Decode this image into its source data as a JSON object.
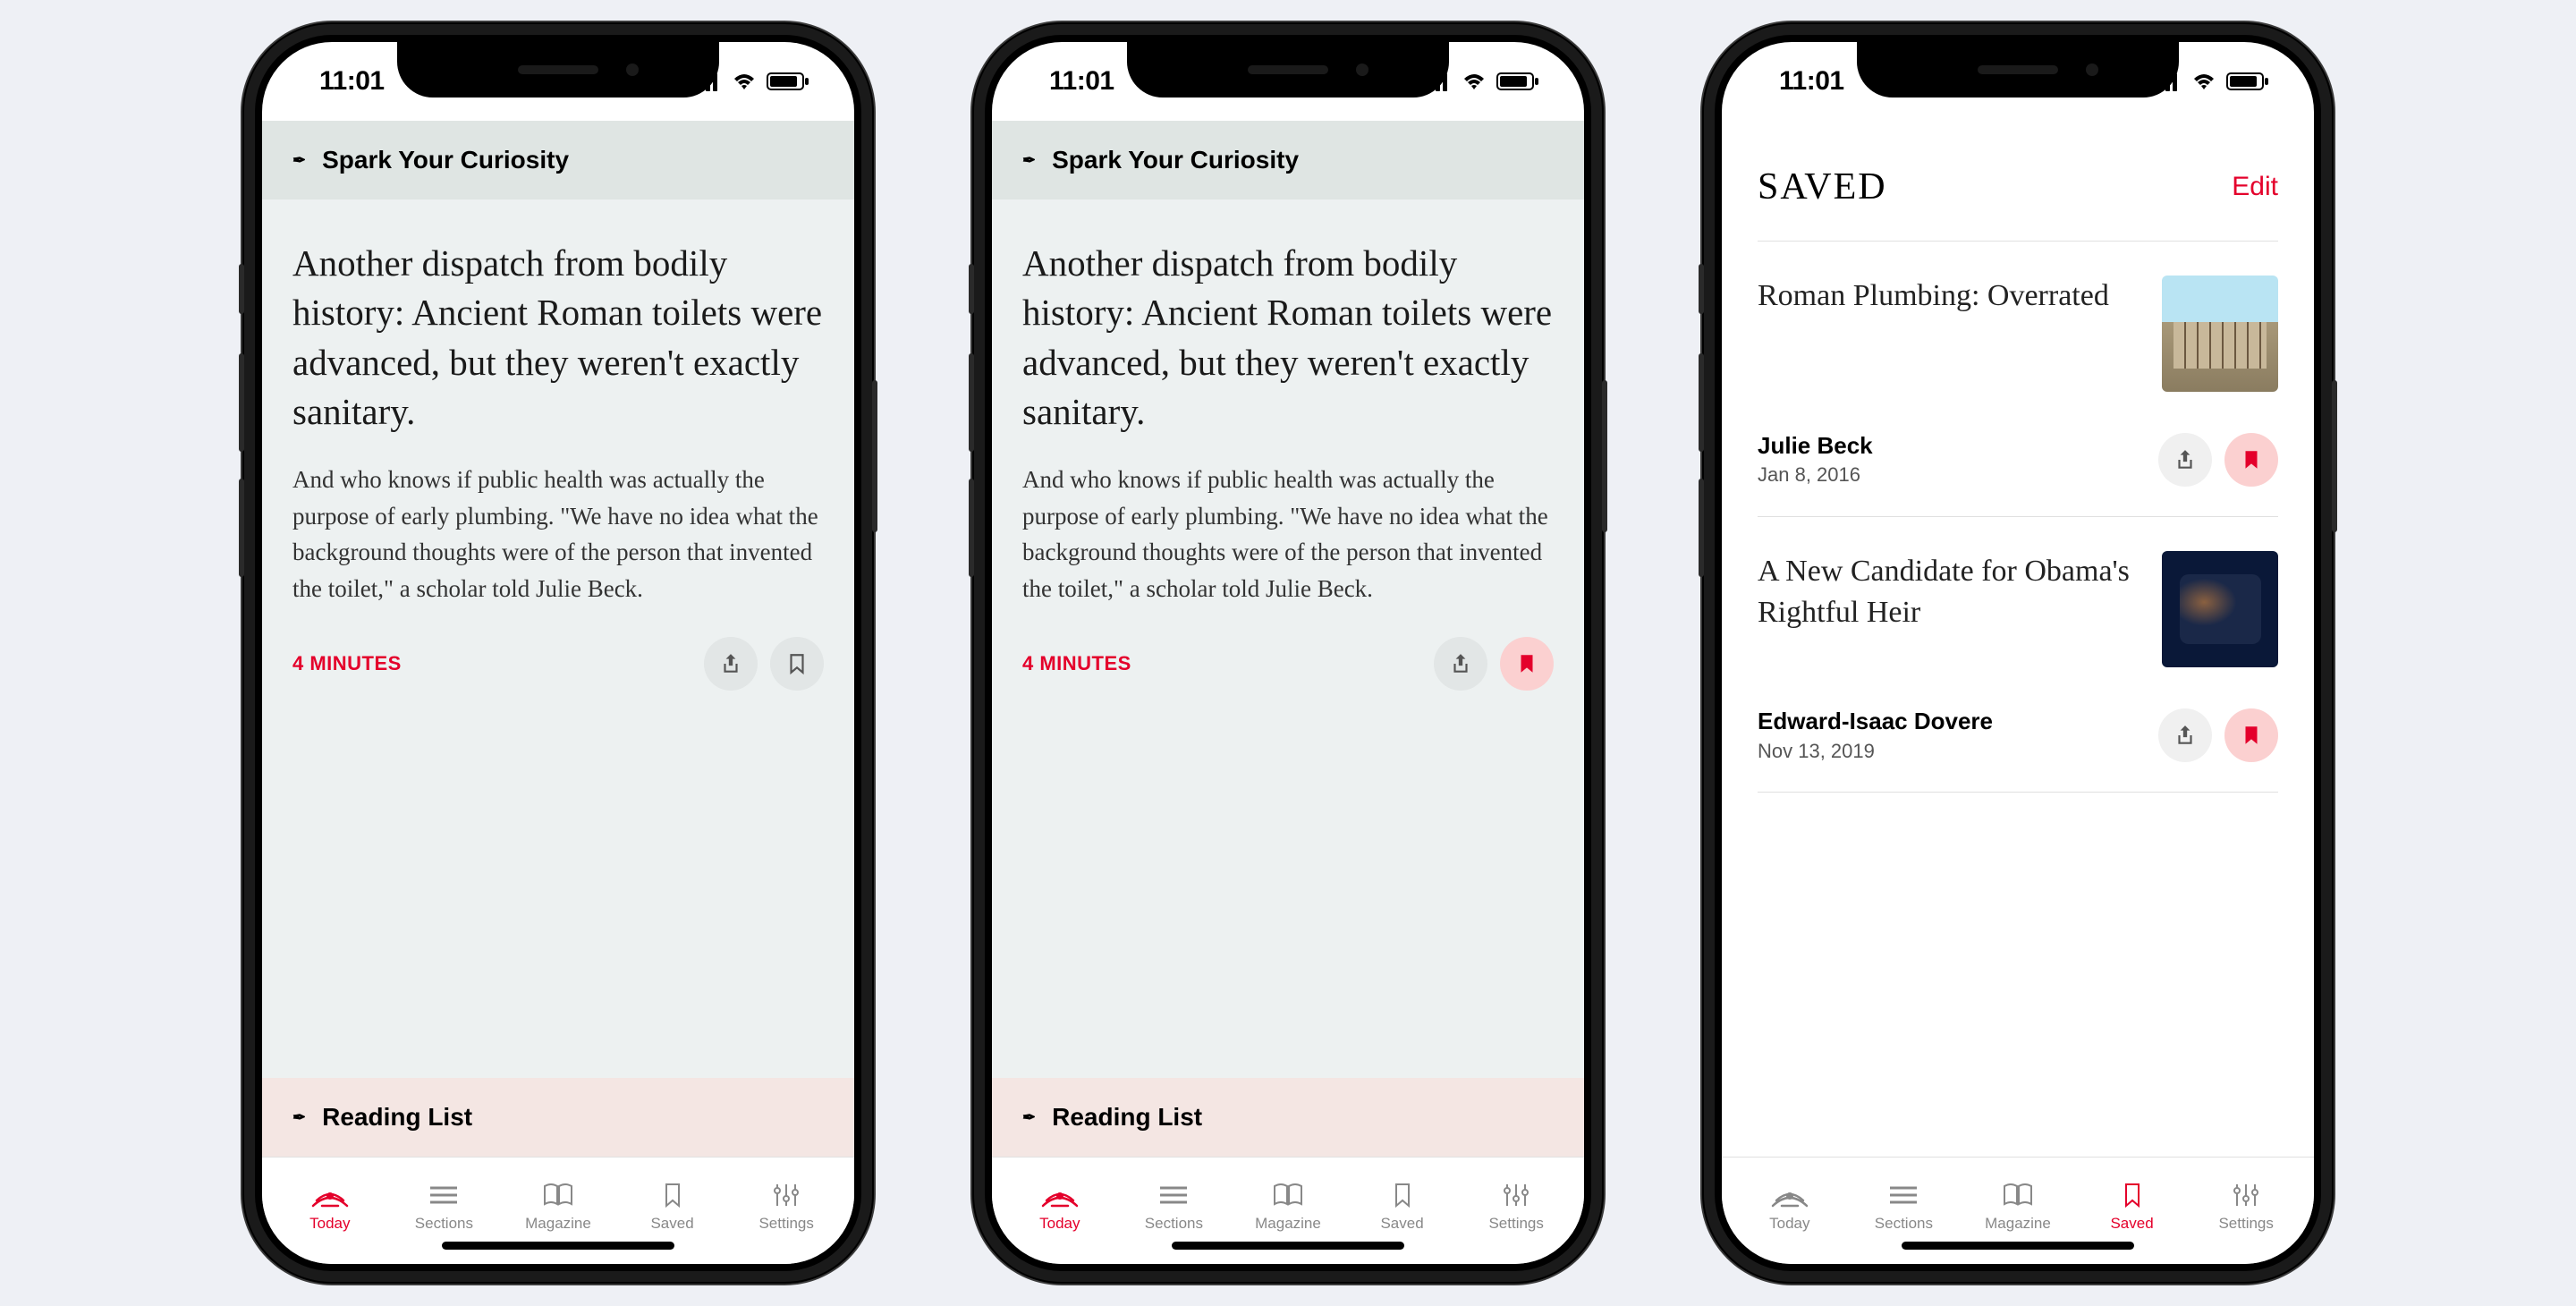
{
  "status": {
    "time": "11:01"
  },
  "section_curiosity": {
    "label": "Spark Your Curiosity"
  },
  "section_reading": {
    "label": "Reading List"
  },
  "article": {
    "headline": "Another dispatch from bodily history: Ancient Roman toilets were advanced, but they weren't exactly sanitary.",
    "excerpt": "And who knows if public health was actually the purpose of early plumbing. \"We have no idea what the background thoughts were of the person that invented the toilet,\" a scholar told Julie Beck.",
    "read_time": "4 MINUTES"
  },
  "saved_screen": {
    "title": "SAVED",
    "edit": "Edit",
    "items": [
      {
        "title": "Roman Plumbing: Overrated",
        "author": "Julie Beck",
        "date": "Jan 8, 2016"
      },
      {
        "title": "A New Candidate for Obama's Rightful Heir",
        "author": "Edward-Isaac Dovere",
        "date": "Nov 13, 2019"
      }
    ]
  },
  "tabs": {
    "today": "Today",
    "sections": "Sections",
    "magazine": "Magazine",
    "saved": "Saved",
    "settings": "Settings"
  },
  "colors": {
    "accent": "#e4002b"
  }
}
